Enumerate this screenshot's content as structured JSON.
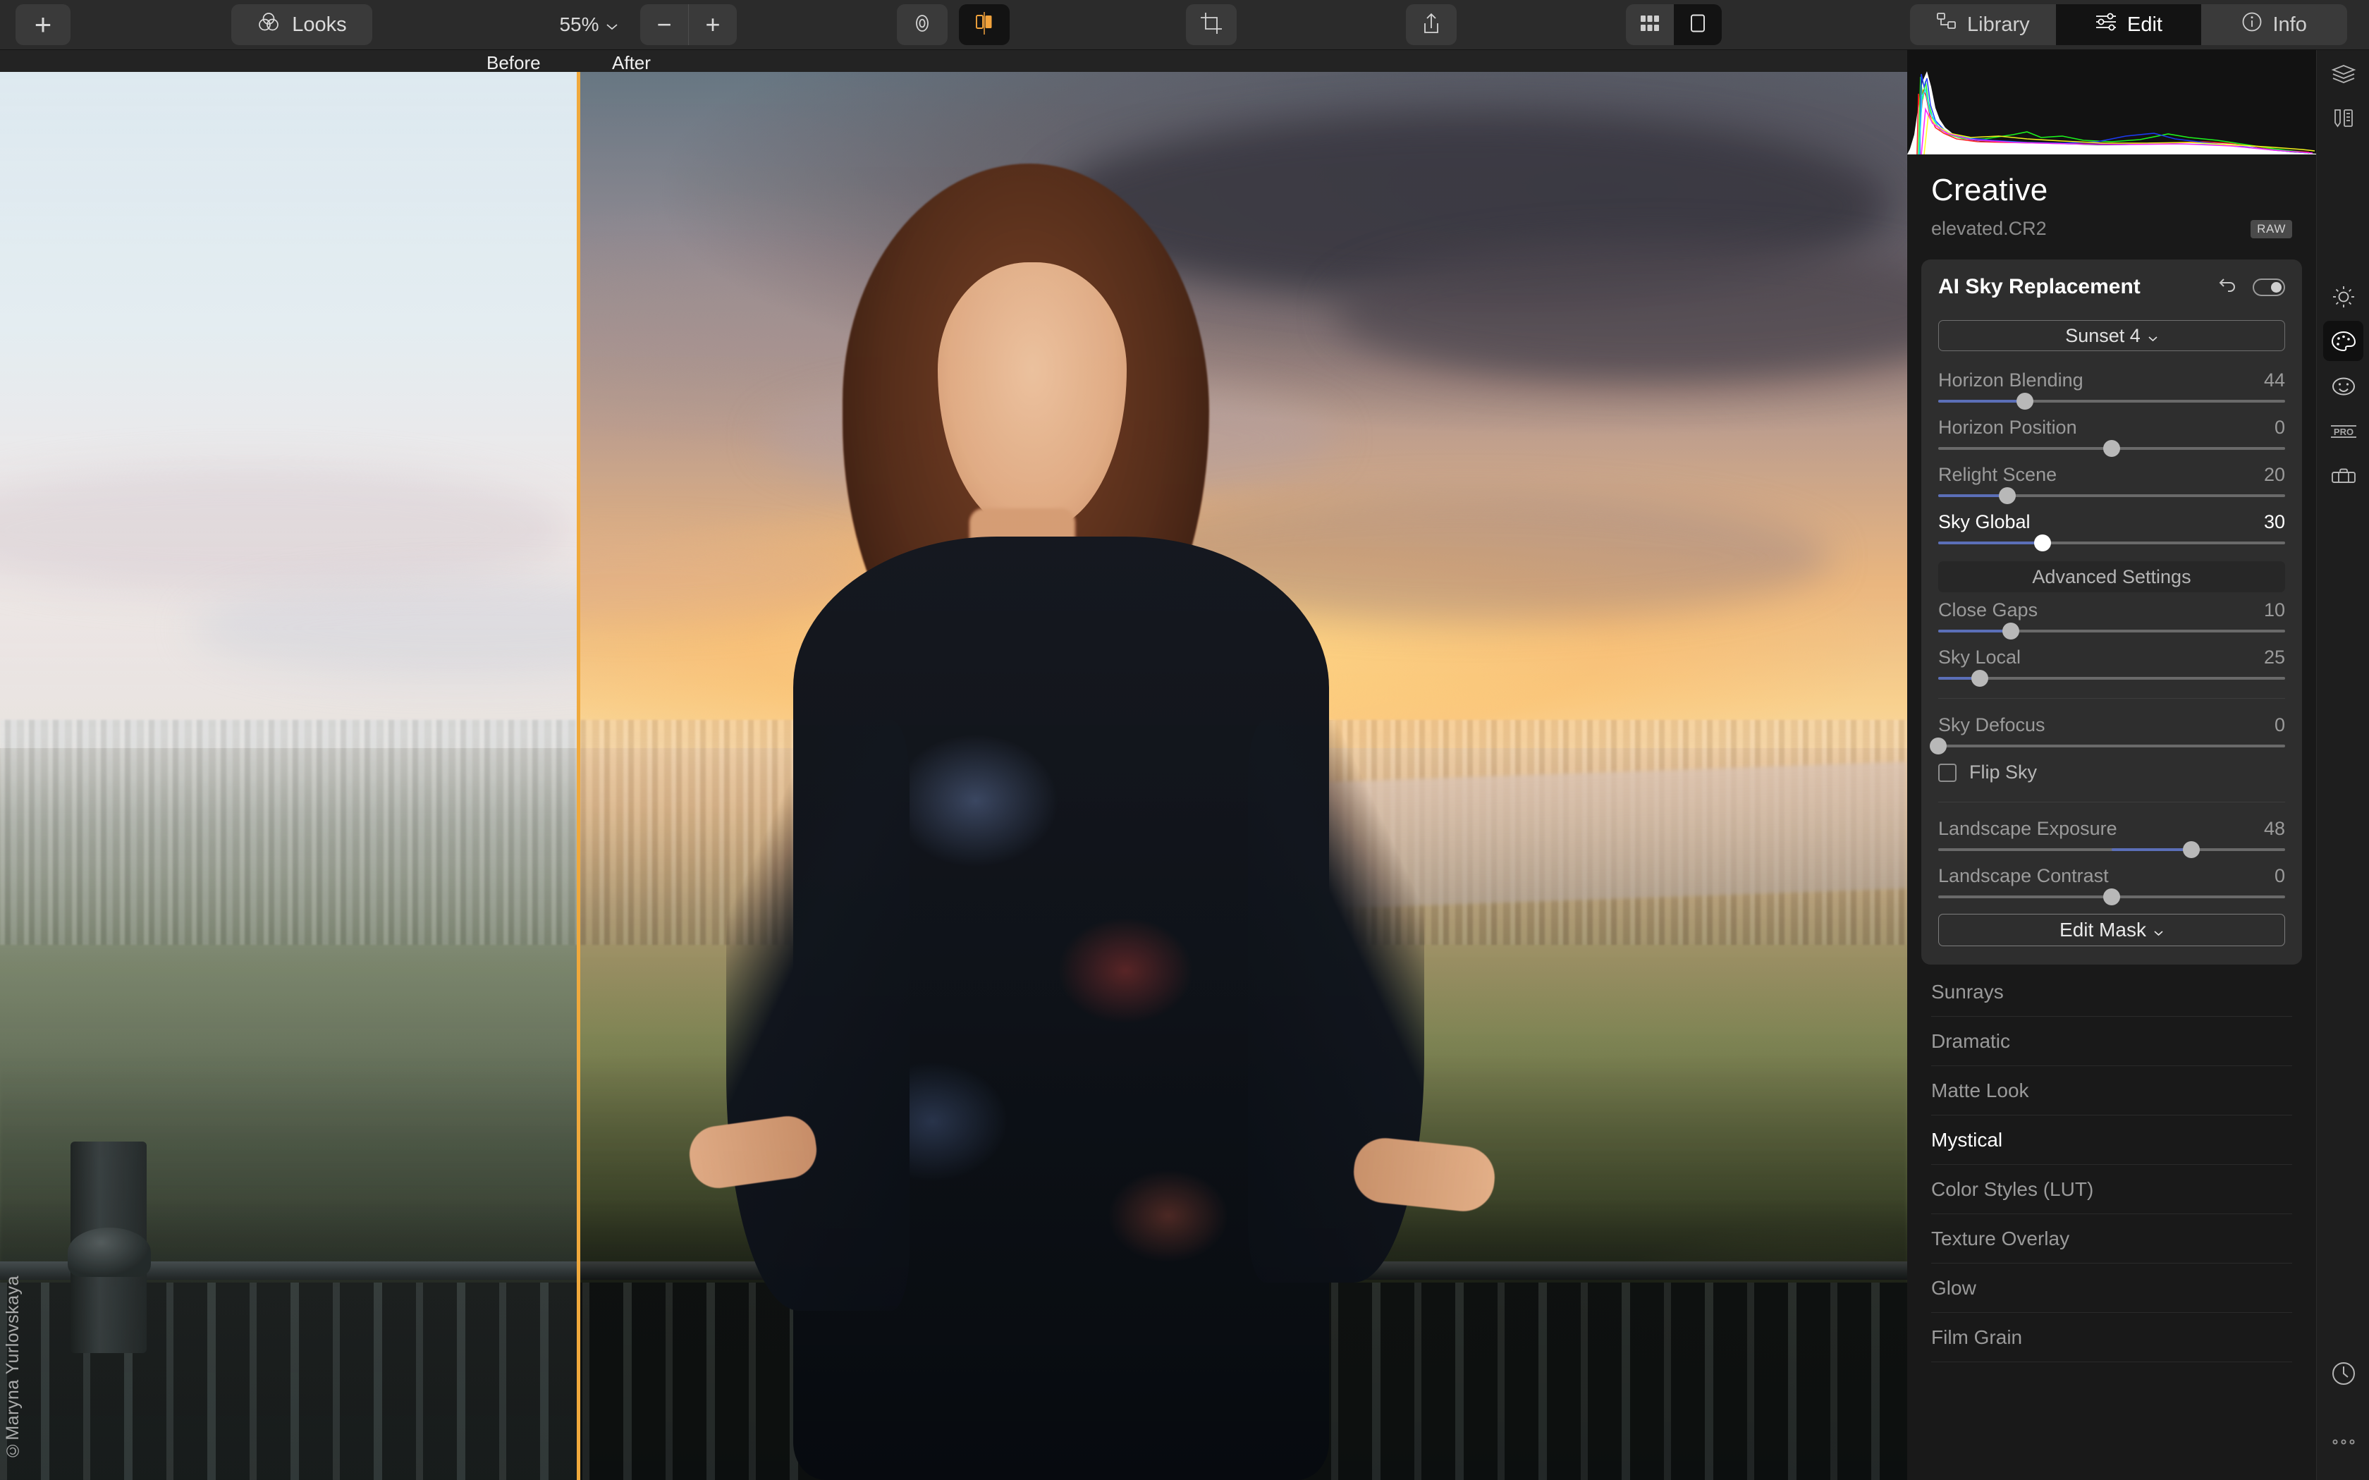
{
  "toolbar": {
    "add_label": "+",
    "looks_label": "Looks",
    "zoom_value": "55%",
    "zoom_out_label": "−",
    "zoom_in_label": "+",
    "icons": {
      "looks": "looks-icon",
      "preview_eye": "eye-icon",
      "compare": "before-after-compare-icon",
      "crop": "crop-icon",
      "share": "share-icon",
      "grid_view": "grid-view-icon",
      "single_view": "single-view-icon"
    },
    "nav": [
      {
        "label": "Library",
        "icon": "library-icon",
        "active": false
      },
      {
        "label": "Edit",
        "icon": "sliders-icon",
        "active": true
      },
      {
        "label": "Info",
        "icon": "info-icon",
        "active": false
      }
    ]
  },
  "canvas": {
    "before_label": "Before",
    "after_label": "After",
    "watermark": "©Maryna Yurlovskaya",
    "split_color": "#f0a93c"
  },
  "panel": {
    "title": "Creative",
    "file_name": "elevated.CR2",
    "file_badge": "RAW",
    "tool": {
      "name": "AI Sky Replacement",
      "reset_icon": "reset-arrow-icon",
      "toggle_icon": "toggle-switch-icon",
      "sky_preset": "Sunset 4",
      "advanced_settings_label": "Advanced Settings",
      "edit_mask_label": "Edit Mask",
      "flip_sky_label": "Flip Sky",
      "flip_sky_checked": false,
      "sliders": [
        {
          "label": "Horizon Blending",
          "value": 44,
          "pos": 25,
          "fill_from": 0,
          "highlight": false
        },
        {
          "label": "Horizon Position",
          "value": 0,
          "pos": 50,
          "fill_from": 50,
          "highlight": false
        },
        {
          "label": "Relight Scene",
          "value": 20,
          "pos": 20,
          "fill_from": 0,
          "highlight": false
        },
        {
          "label": "Sky Global",
          "value": 30,
          "pos": 30,
          "fill_from": 0,
          "highlight": true
        }
      ],
      "sliders_advanced": [
        {
          "label": "Close Gaps",
          "value": 10,
          "pos": 21,
          "fill_from": 0,
          "highlight": false
        },
        {
          "label": "Sky Local",
          "value": 25,
          "pos": 12,
          "fill_from": 0,
          "highlight": false
        },
        {
          "label": "Sky Defocus",
          "value": 0,
          "pos": 0,
          "fill_from": 0,
          "highlight": false
        }
      ],
      "sliders_landscape": [
        {
          "label": "Landscape Exposure",
          "value": 48,
          "pos": 73,
          "fill_from": 50,
          "highlight": false
        },
        {
          "label": "Landscape Contrast",
          "value": 0,
          "pos": 50,
          "fill_from": 50,
          "highlight": false
        }
      ]
    },
    "tool_list": [
      {
        "label": "Sunrays",
        "highlight": false
      },
      {
        "label": "Dramatic",
        "highlight": false
      },
      {
        "label": "Matte Look",
        "highlight": false
      },
      {
        "label": "Mystical",
        "highlight": true
      },
      {
        "label": "Color Styles (LUT)",
        "highlight": false
      },
      {
        "label": "Texture Overlay",
        "highlight": false
      },
      {
        "label": "Glow",
        "highlight": false
      },
      {
        "label": "Film Grain",
        "highlight": false
      }
    ],
    "accent_color": "#5b6fb8"
  },
  "rail": {
    "items": [
      {
        "name": "layers-icon",
        "selected": false
      },
      {
        "name": "tools-icon",
        "selected": false
      },
      {
        "name": "essentials-sun-icon",
        "selected": false
      },
      {
        "name": "creative-palette-icon",
        "selected": true
      },
      {
        "name": "portrait-face-icon",
        "selected": false
      },
      {
        "name": "pro-icon",
        "selected": false
      },
      {
        "name": "toolkit-icon",
        "selected": false
      },
      {
        "name": "history-clock-icon",
        "selected": false
      },
      {
        "name": "more-dots-icon",
        "selected": false
      }
    ]
  }
}
